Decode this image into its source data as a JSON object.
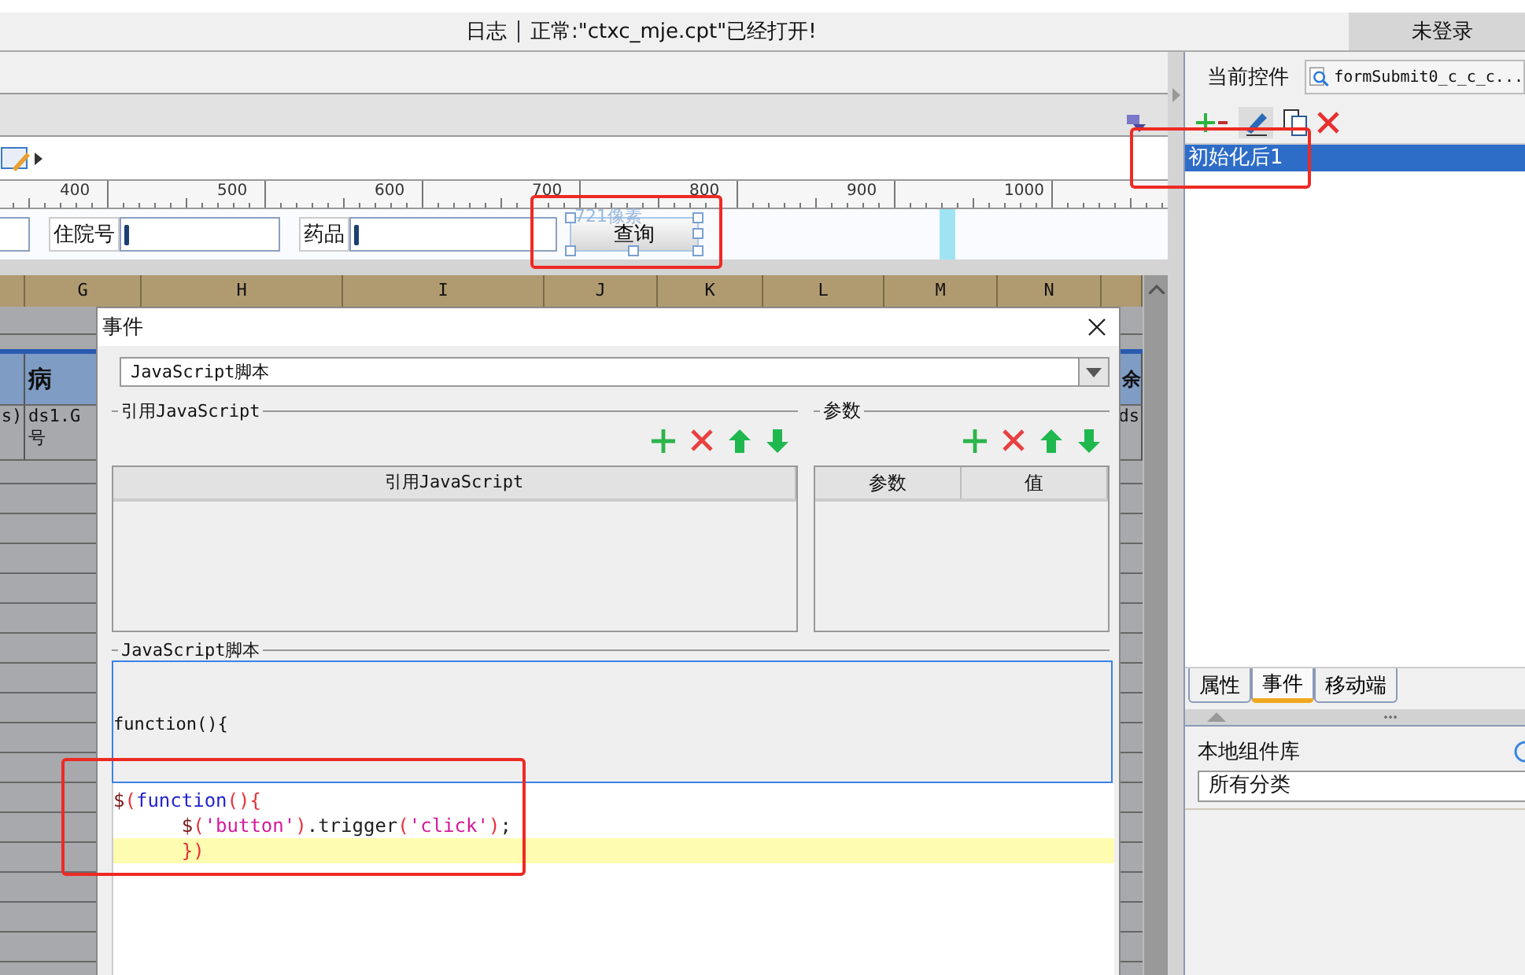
{
  "status_bar": {
    "log_label": "日志",
    "message": "正常:\"ctxc_mje.cpt\"已经打开!",
    "login": "未登录"
  },
  "ruler": {
    "labels": [
      "400",
      "500",
      "600",
      "700",
      "800",
      "900",
      "1000"
    ]
  },
  "form": {
    "fields": [
      {
        "label": "住院号"
      },
      {
        "label": "药品"
      }
    ],
    "button": "查询",
    "size_hint": "721像素"
  },
  "sheet": {
    "columns": [
      "",
      "G",
      "H",
      "I",
      "J",
      "K",
      "L",
      "M",
      "N",
      ""
    ],
    "rows": [
      {
        "kind": "header",
        "cells": [
          [],
          [
            "病"
          ],
          [],
          [],
          [],
          [],
          [],
          [],
          [],
          [
            "余"
          ]
        ]
      },
      {
        "kind": "data",
        "cells": [
          [
            "s)"
          ],
          [
            "ds1.G",
            "号"
          ],
          [],
          [],
          [],
          [],
          [],
          [],
          [],
          [
            "ds"
          ]
        ]
      }
    ]
  },
  "dialog": {
    "title": "事件",
    "type_select": "JavaScript脚本",
    "ref_group": {
      "legend": "引用JavaScript",
      "columns": [
        "引用JavaScript"
      ]
    },
    "param_group": {
      "legend": "参数",
      "columns": [
        "参数",
        "值"
      ]
    },
    "script_group": {
      "legend": "JavaScript脚本",
      "header_line": "function(){",
      "lines": [
        {
          "highlighted": false,
          "tokens": [
            {
              "kind": "ident",
              "text": "$"
            },
            {
              "kind": "paren",
              "text": "("
            },
            {
              "kind": "keyword",
              "text": "function"
            },
            {
              "kind": "paren",
              "text": "(){"
            }
          ]
        },
        {
          "highlighted": false,
          "tokens": [
            {
              "kind": "ident",
              "text": "      $"
            },
            {
              "kind": "paren",
              "text": "("
            },
            {
              "kind": "string",
              "text": "'button'"
            },
            {
              "kind": "paren",
              "text": ")"
            },
            {
              "kind": "plain",
              "text": ".trigger"
            },
            {
              "kind": "paren",
              "text": "("
            },
            {
              "kind": "string",
              "text": "'click'"
            },
            {
              "kind": "paren",
              "text": ")"
            },
            {
              "kind": "plain",
              "text": ";"
            }
          ]
        },
        {
          "highlighted": true,
          "tokens": [
            {
              "kind": "paren",
              "text": "      })"
            }
          ]
        }
      ]
    }
  },
  "side_panel": {
    "current_label": "当前控件",
    "current_value": "formSubmit0_c_c_c...",
    "events": [
      {
        "label": "初始化后1",
        "selected": true
      }
    ],
    "tabs": [
      {
        "label": "属性",
        "selected": false
      },
      {
        "label": "事件",
        "selected": true
      },
      {
        "label": "移动端",
        "selected": false
      }
    ],
    "library_label": "本地组件库",
    "category": "所有分类"
  }
}
